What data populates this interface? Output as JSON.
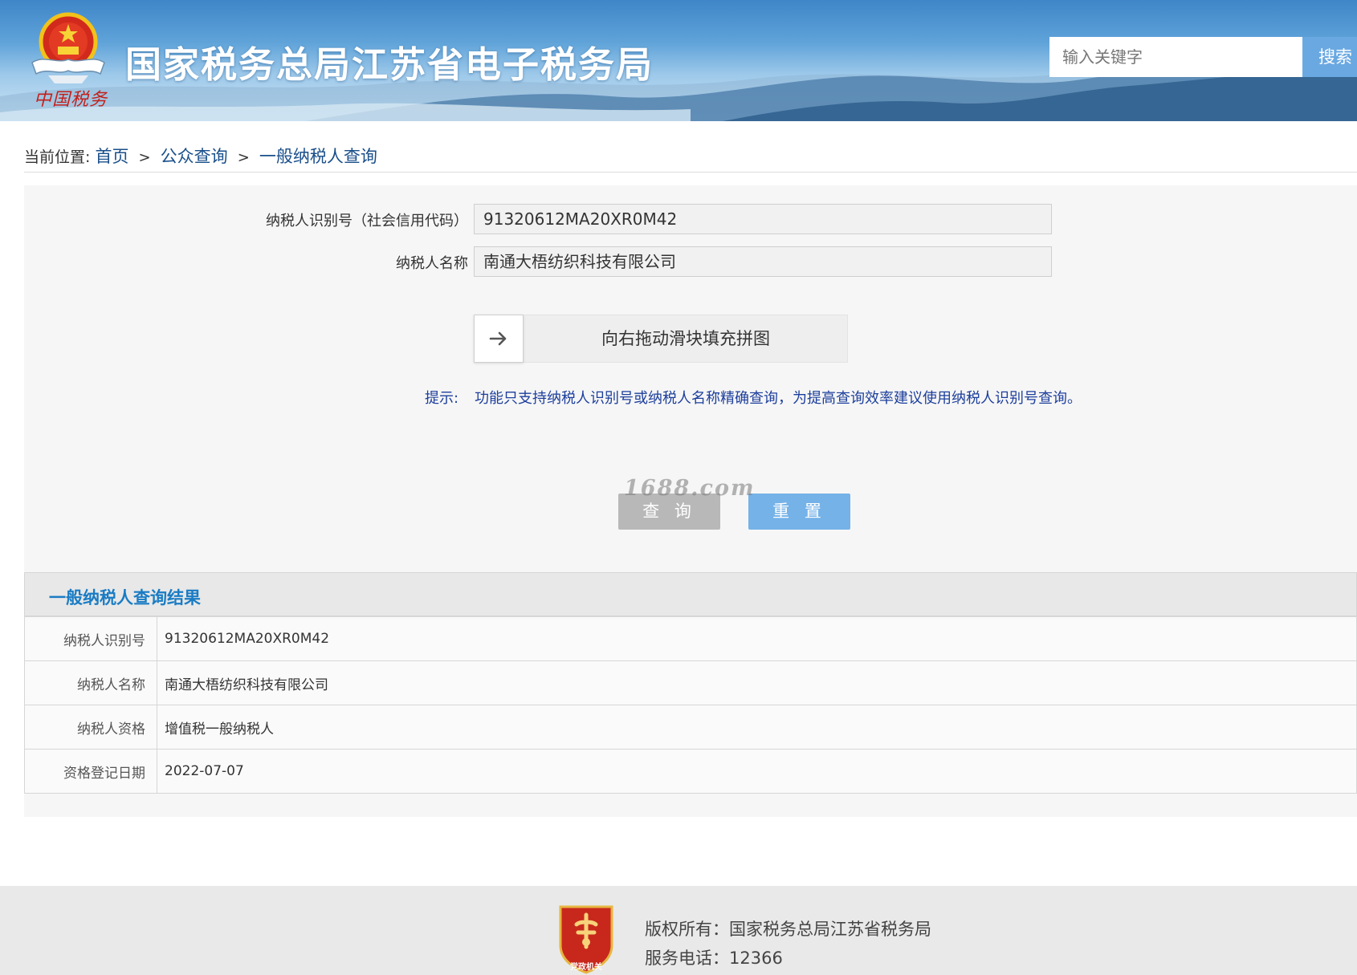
{
  "header": {
    "site_title": "国家税务总局江苏省电子税务局",
    "emblem_caption": "中国税务",
    "search_placeholder": "输入关键字",
    "search_button": "搜索"
  },
  "breadcrumb": {
    "prefix": "当前位置:",
    "items": [
      "首页",
      "公众查询",
      "一般纳税人查询"
    ],
    "separator": ">"
  },
  "form": {
    "taxpayer_id_label": "纳税人识别号（社会信用代码）",
    "taxpayer_id_value": "91320612MA20XR0M42",
    "taxpayer_name_label": "纳税人名称",
    "taxpayer_name_value": "南通大梧纺织科技有限公司",
    "slider_text": "向右拖动滑块填充拼图",
    "tip_label": "提示:",
    "tip_text": "功能只支持纳税人识别号或纳税人名称精确查询，为提高查询效率建议使用纳税人识别号查询。",
    "query_button": "查 询",
    "reset_button": "重 置",
    "watermark": "1688.com"
  },
  "results": {
    "title": "一般纳税人查询结果",
    "rows": [
      {
        "label": "纳税人识别号",
        "value": "91320612MA20XR0M42"
      },
      {
        "label": "纳税人名称",
        "value": "南通大梧纺织科技有限公司"
      },
      {
        "label": "纳税人资格",
        "value": "增值税一般纳税人"
      },
      {
        "label": "资格登记日期",
        "value": "2022-07-07"
      }
    ]
  },
  "footer": {
    "logo_caption": "党政机关",
    "copyright": "版权所有：国家税务总局江苏省税务局",
    "phone": "服务电话：12366"
  },
  "colors": {
    "header_blue": "#3f86c8",
    "link_blue": "#1a4f8a",
    "tip_blue": "#1d3f9c",
    "result_title_blue": "#1a7cc4",
    "query_button_gray": "#b8b8b8",
    "reset_button_blue": "#75b2e8"
  },
  "icons": {
    "slider_handle": "arrow-right-icon",
    "emblem": "national-emblem-icon",
    "footer_logo": "party-government-badge-icon"
  }
}
